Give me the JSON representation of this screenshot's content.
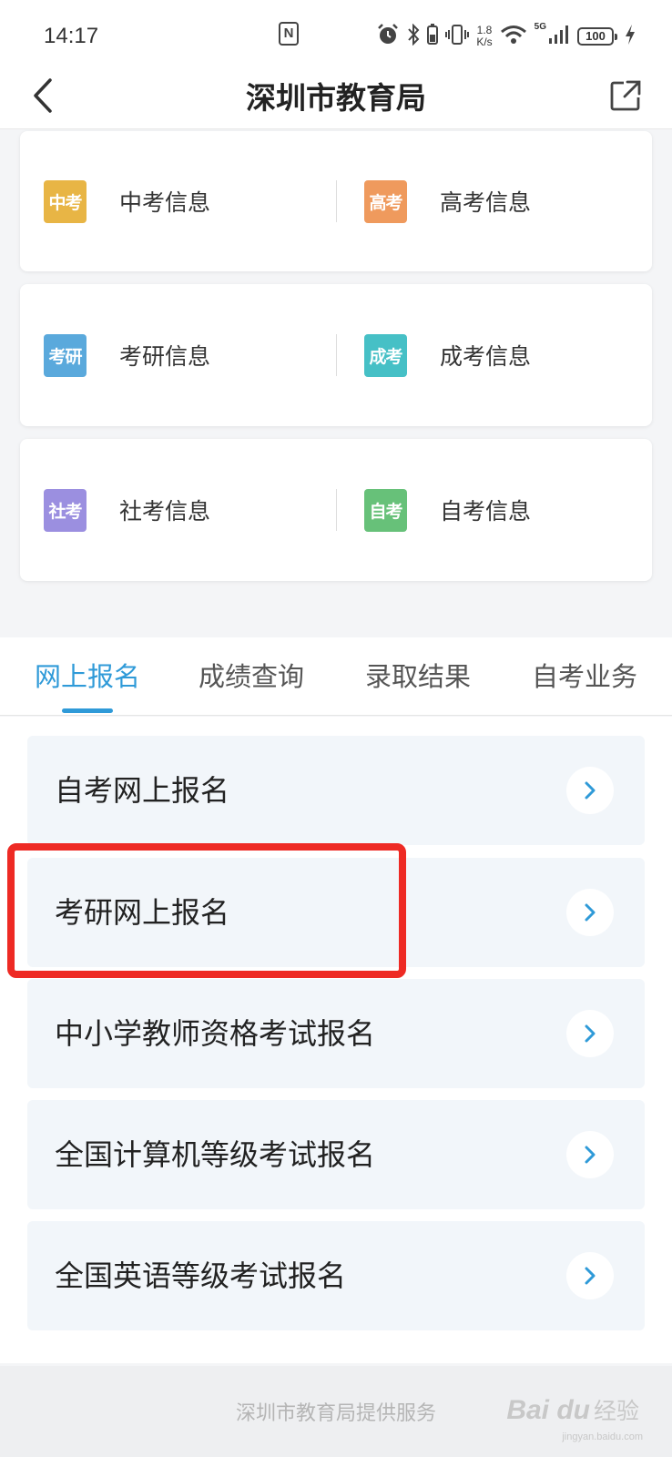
{
  "status_bar": {
    "time": "14:17",
    "nfc": "N",
    "net_speed_value": "1.8",
    "net_speed_unit": "K/s",
    "network_gen": "5G",
    "battery": "100",
    "icons": [
      "nfc-icon",
      "alarm-icon",
      "bluetooth-icon",
      "vibrate-icon",
      "wifi-icon",
      "signal-icon",
      "battery-icon",
      "charging-icon"
    ]
  },
  "header": {
    "title": "深圳市教育局",
    "back_icon": "chevron-left-icon",
    "share_icon": "share-icon"
  },
  "info_cards": [
    {
      "left": {
        "badge": "中考",
        "badge_color": "#e8b545",
        "label": "中考信息"
      },
      "right": {
        "badge": "高考",
        "badge_color": "#ef9a5d",
        "label": "高考信息"
      }
    },
    {
      "left": {
        "badge": "考研",
        "badge_color": "#5aa9dc",
        "label": "考研信息"
      },
      "right": {
        "badge": "成考",
        "badge_color": "#46c0c6",
        "label": "成考信息"
      }
    },
    {
      "left": {
        "badge": "社考",
        "badge_color": "#9b8fe0",
        "label": "社考信息"
      },
      "right": {
        "badge": "自考",
        "badge_color": "#67c179",
        "label": "自考信息"
      }
    }
  ],
  "tabs": [
    {
      "label": "网上报名",
      "active": true
    },
    {
      "label": "成绩查询",
      "active": false
    },
    {
      "label": "录取结果",
      "active": false
    },
    {
      "label": "自考业务",
      "active": false
    }
  ],
  "list_items": [
    {
      "label": "自考网上报名"
    },
    {
      "label": "考研网上报名"
    },
    {
      "label": "中小学教师资格考试报名"
    },
    {
      "label": "全国计算机等级考试报名"
    },
    {
      "label": "全国英语等级考试报名"
    }
  ],
  "footer": {
    "text": "深圳市教育局提供服务"
  },
  "watermark": {
    "brand": "Bai du",
    "cn": "经验",
    "url": "jingyan.baidu.com"
  },
  "colors": {
    "accent": "#2f9ad8",
    "highlight": "#ee2a24",
    "list_bg": "#f2f6fa"
  }
}
